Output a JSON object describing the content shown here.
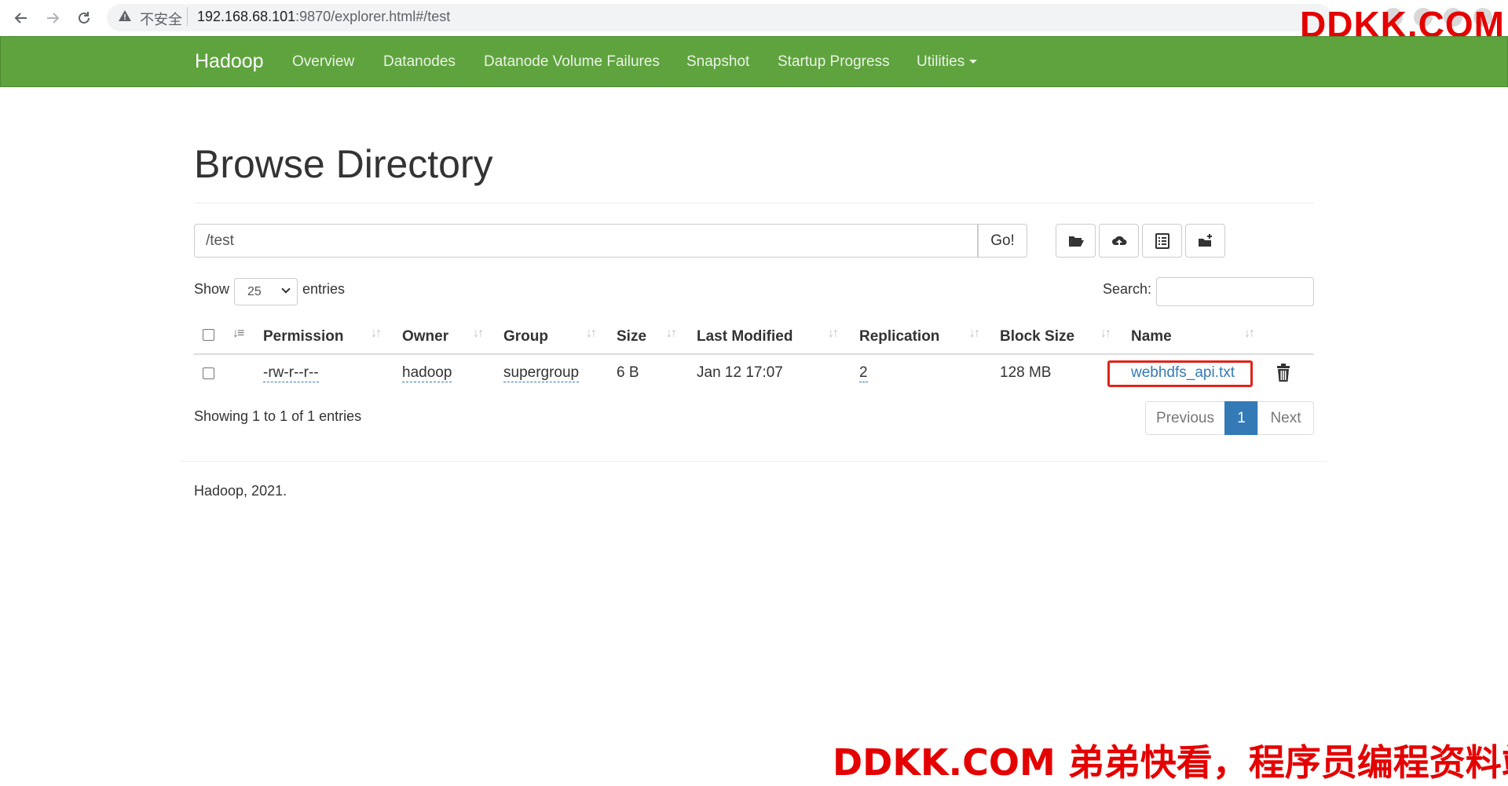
{
  "browser": {
    "insecure_label": "不安全",
    "url_host": "192.168.68.101",
    "url_rest": ":9870/explorer.html#/test"
  },
  "watermark": {
    "top": "DDKK.COM",
    "bottom": "DDKK.COM 弟弟快看，程序员编程资料站"
  },
  "navbar": {
    "brand": "Hadoop",
    "links": [
      "Overview",
      "Datanodes",
      "Datanode Volume Failures",
      "Snapshot",
      "Startup Progress",
      "Utilities"
    ]
  },
  "page": {
    "title": "Browse Directory",
    "path_value": "/test",
    "go_label": "Go!"
  },
  "toolbar": {
    "icons": [
      "folder-open-icon",
      "cloud-upload-icon",
      "list-alt-icon",
      "folder-plus-icon"
    ]
  },
  "list_controls": {
    "show_label": "Show",
    "page_size": "25",
    "entries_label": "entries",
    "search_label": "Search:",
    "search_value": ""
  },
  "table": {
    "columns": [
      "Permission",
      "Owner",
      "Group",
      "Size",
      "Last Modified",
      "Replication",
      "Block Size",
      "Name"
    ],
    "rows": [
      {
        "permission": "-rw-r--r--",
        "owner": "hadoop",
        "group": "supergroup",
        "size": "6 B",
        "last_modified": "Jan 12 17:07",
        "replication": "2",
        "block_size": "128 MB",
        "name": "webhdfs_api.txt"
      }
    ]
  },
  "pagination": {
    "info": "Showing 1 to 1 of 1 entries",
    "previous": "Previous",
    "current": "1",
    "next": "Next"
  },
  "footer": {
    "text": "Hadoop, 2021."
  },
  "colors": {
    "navbar": "#5fa33e",
    "link": "#337ab7",
    "highlight_box": "#e0241b",
    "watermark": "#e50000"
  }
}
